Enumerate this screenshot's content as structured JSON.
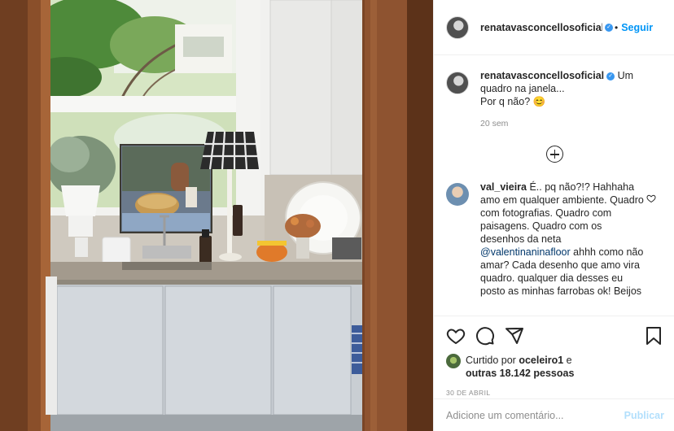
{
  "post": {
    "username": "renatavasconcellosoficial",
    "follow_label": "Seguir",
    "separator": "•",
    "caption": {
      "username": "renatavasconcellosoficial",
      "text": " Um quadro na janela...",
      "text2": "Por q não? 😊",
      "time": "20 sem"
    },
    "comment": {
      "username": "val_vieira",
      "text_before": " É.. pq não?!? Hahhaha amo em qualquer ambiente. Quadro com fotografias. Quadro com paisagens. Quadro com os desenhos da neta ",
      "mention": "@valentinaninafloor",
      "text_after": " ahhh como não amar? Cada desenho que amo vira quadro. qualquer dia desses eu posto as minhas farrobas ok! Beijos"
    },
    "likes": {
      "prefix": "Curtido por ",
      "liker": "oceleiro1",
      "mid": " e",
      "others": "outras 18.142 pessoas"
    },
    "date": "30 DE ABRIL",
    "add_comment": {
      "placeholder": "Adicione um comentário...",
      "publish_label": "Publicar"
    },
    "icons": [
      "heart-icon",
      "comment-icon",
      "share-icon",
      "bookmark-icon",
      "add-comment-icon",
      "verified-icon"
    ],
    "colors": {
      "accent": "#0095f6",
      "verified": "#3897f0",
      "publish_disabled": "#b2dffc",
      "muted": "#8e8e8e"
    }
  }
}
